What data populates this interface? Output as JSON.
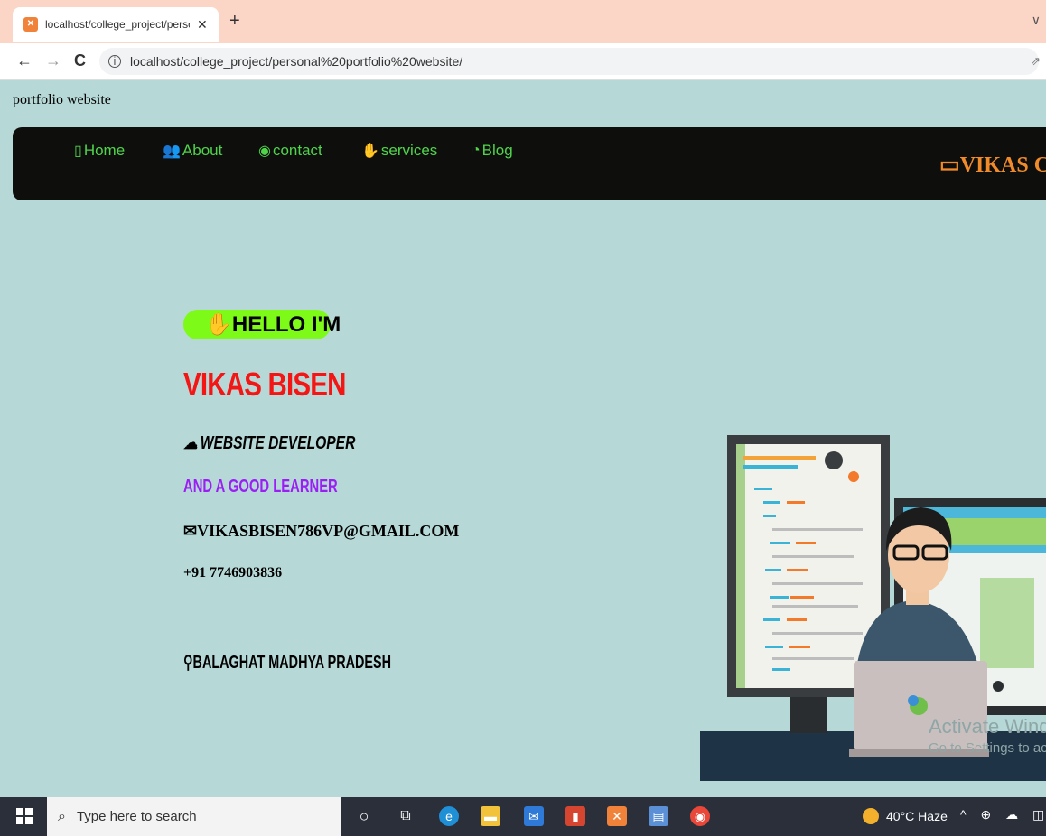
{
  "browser": {
    "tab_title": "localhost/college_project/person",
    "tab_close": "✕",
    "new_tab": "+",
    "tab_menu": "∨",
    "back": "←",
    "forward": "→",
    "reload": "C",
    "info": "i",
    "url": "localhost/college_project/personal%20portfolio%20website/",
    "share": "⇗"
  },
  "page": {
    "doc_title": "portfolio website",
    "nav": [
      {
        "icon": "home-icon",
        "label": "Home"
      },
      {
        "icon": "users-icon",
        "label": "About"
      },
      {
        "icon": "contact-icon",
        "label": "contact"
      },
      {
        "icon": "handshake-icon",
        "label": "services"
      },
      {
        "icon": "blog-icon",
        "label": "Blog"
      }
    ],
    "brand": "VIKAS C",
    "hello": "HELLO I'M",
    "name": "VIKAS BISEN",
    "role": "WEBSITE DEVELOPER",
    "tagline": "AND A GOOD LEARNER",
    "email": "VIKASBISEN786VP@GMAIL.COM",
    "phone": "+91 7746903836",
    "location": "BALAGHAT MADHYA PRADESH",
    "colors": {
      "background": "#b6d9d8",
      "navbar": "#0e0f0d",
      "nav_text": "#4fd44a",
      "brand": "#f18b2a",
      "hello_badge": "#7dfa17",
      "name": "#f41515",
      "tagline": "#9b1ef5"
    }
  },
  "watermark": {
    "line1": "Activate Windo",
    "line2": "Go to Settings to act"
  },
  "taskbar": {
    "search_placeholder": "Type here to search",
    "weather": "40°C  Haze",
    "tray": "^ ⊕ ☁ ◫"
  }
}
